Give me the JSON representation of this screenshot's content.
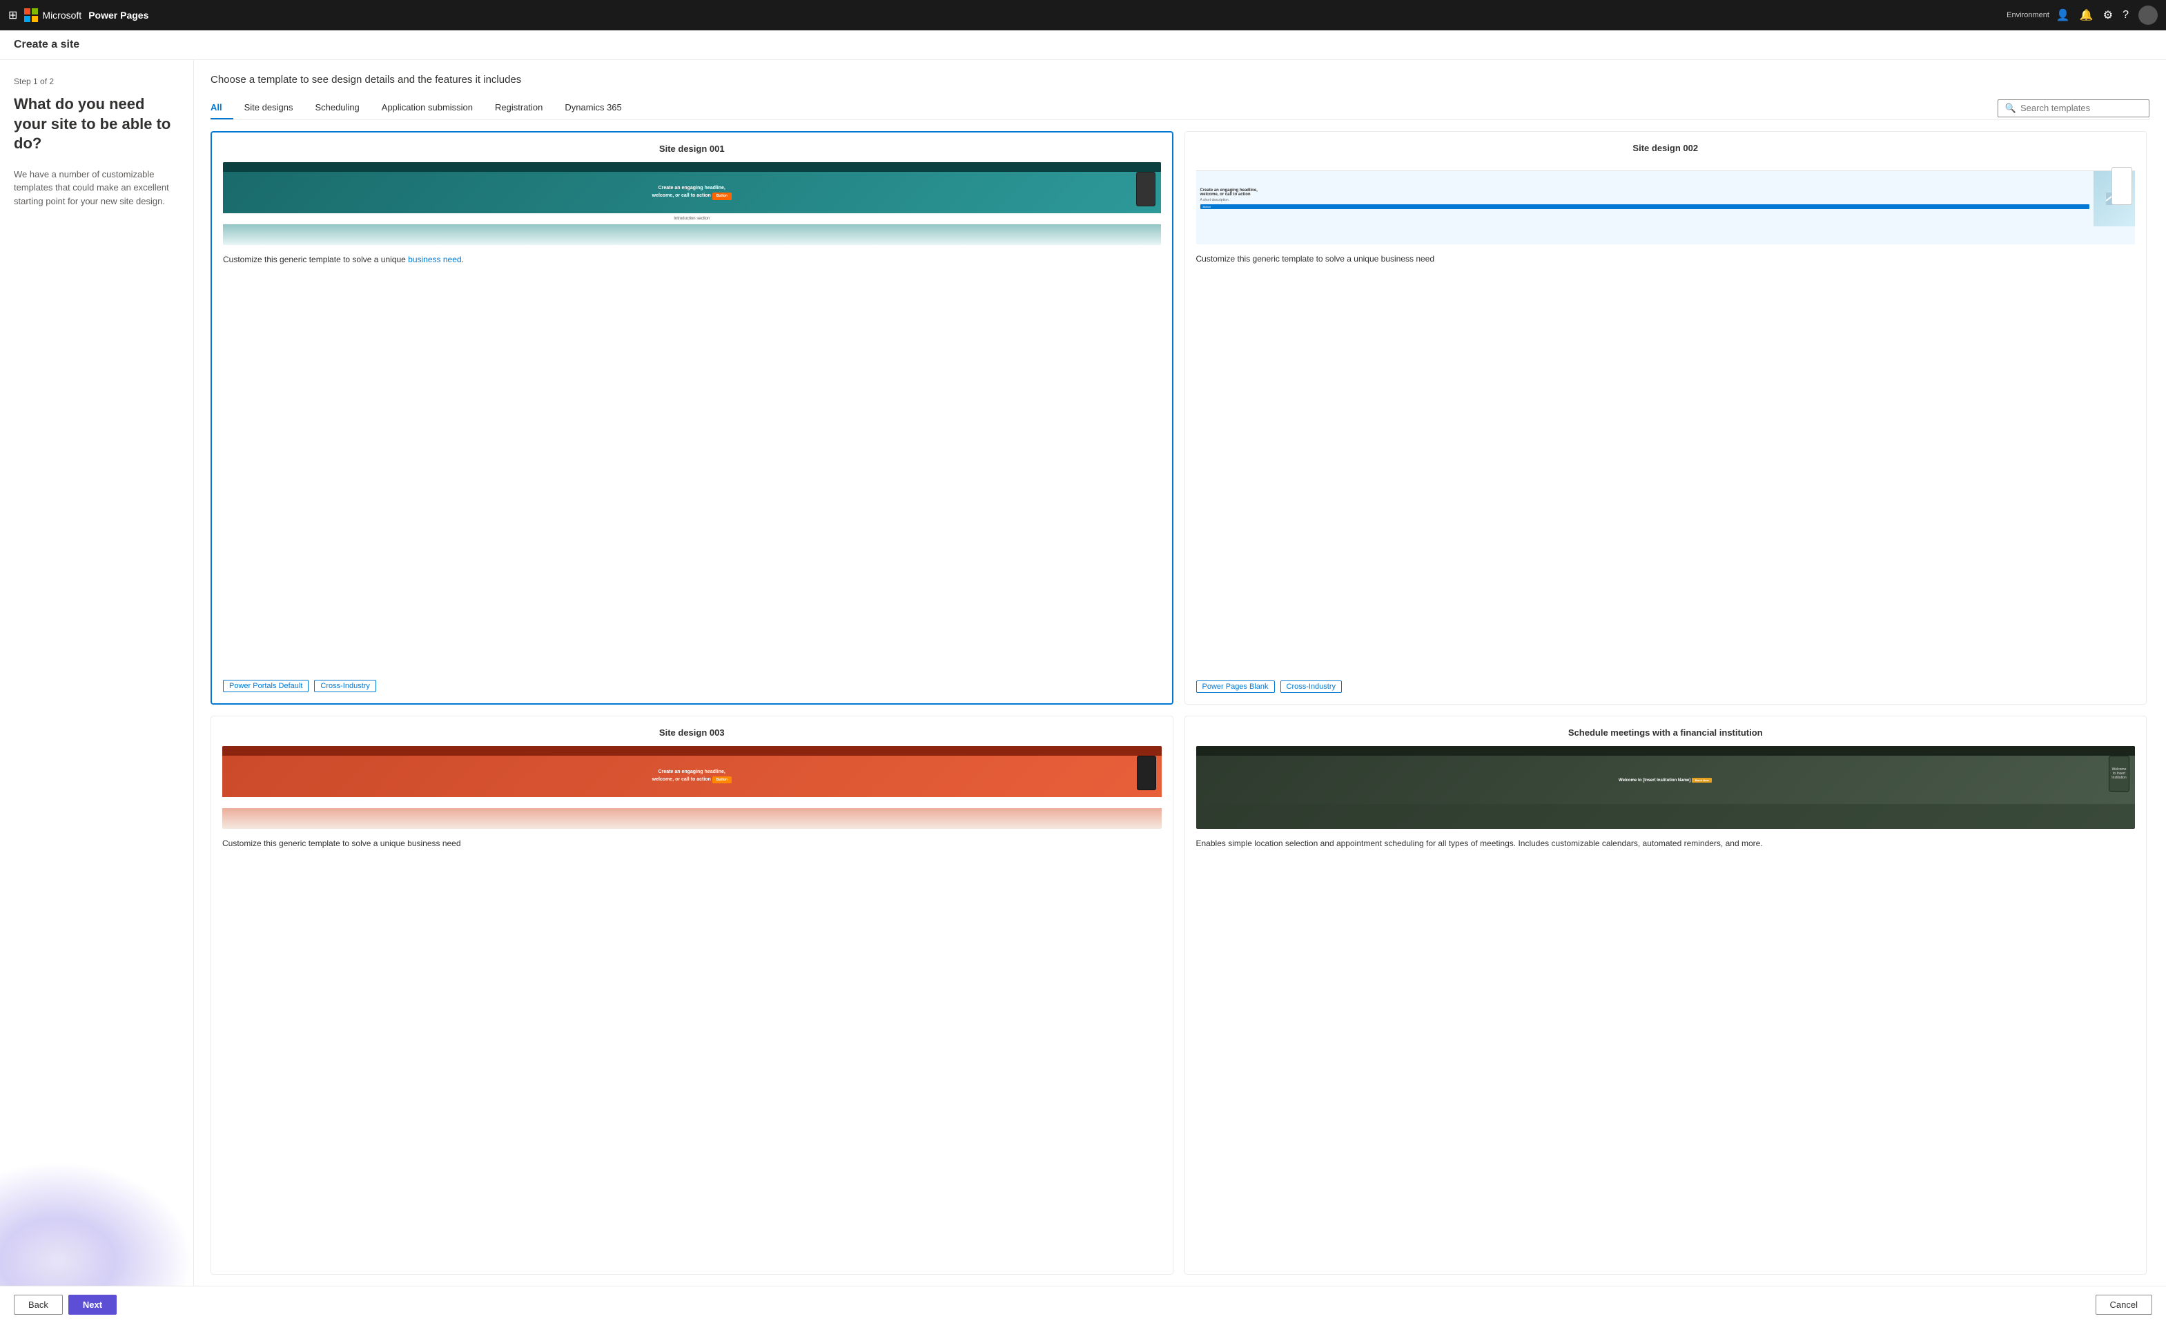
{
  "topnav": {
    "brand": "Microsoft",
    "appname": "Power Pages",
    "env_label": "Environment"
  },
  "page_header": {
    "title": "Create a site"
  },
  "left_panel": {
    "step_label": "Step 1 of 2",
    "question": "What do you need your site to be able to do?",
    "description": "We have a number of customizable templates that could make an excellent starting point for your new site design."
  },
  "panel_title": "Choose a template to see design details and the features it includes",
  "tabs": [
    {
      "label": "All",
      "active": true
    },
    {
      "label": "Site designs"
    },
    {
      "label": "Scheduling"
    },
    {
      "label": "Application submission"
    },
    {
      "label": "Registration"
    },
    {
      "label": "Dynamics 365"
    }
  ],
  "search": {
    "placeholder": "Search templates"
  },
  "templates": [
    {
      "id": "001",
      "title": "Site design 001",
      "description": "Customize this generic template to solve a unique business need.",
      "link_word": "business need",
      "selected": true,
      "tags": [
        "Power Portals Default",
        "Cross-Industry"
      ]
    },
    {
      "id": "002",
      "title": "Site design 002",
      "description": "Customize this generic template to solve a unique business need",
      "selected": false,
      "tags": [
        "Power Pages Blank",
        "Cross-Industry"
      ]
    },
    {
      "id": "003",
      "title": "Site design 003",
      "description": "Customize this generic template to solve a unique business need",
      "selected": false,
      "tags": []
    },
    {
      "id": "fin",
      "title": "Schedule meetings with a financial institution",
      "description": "Enables simple location selection and appointment scheduling for all types of meetings. Includes customizable calendars, automated reminders, and more.",
      "selected": false,
      "tags": []
    }
  ],
  "footer": {
    "back_label": "Back",
    "next_label": "Next",
    "cancel_label": "Cancel"
  }
}
